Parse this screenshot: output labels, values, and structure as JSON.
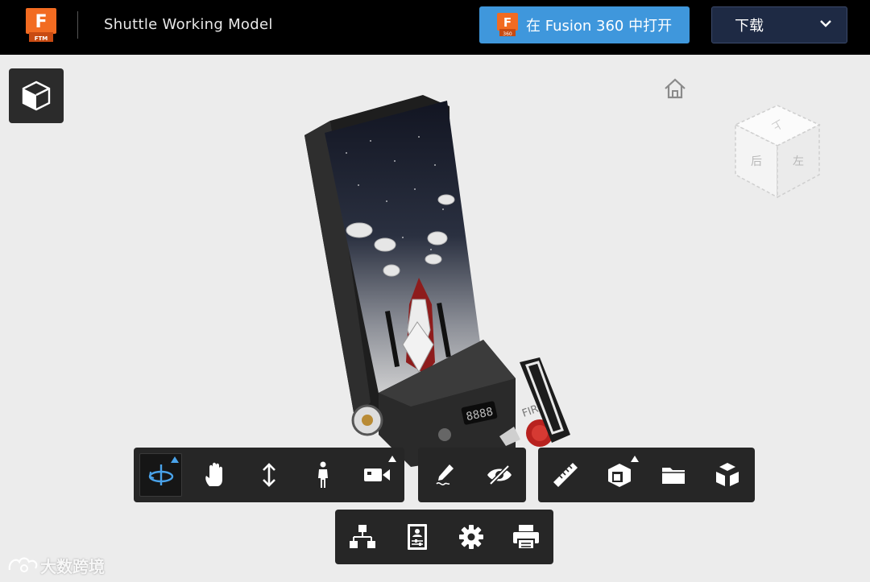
{
  "header": {
    "logo_label": "FTM",
    "doc_title": "Shuttle Working Model",
    "open_button_label": "在 Fusion 360 中打开",
    "open_button_badge": "360",
    "download_label": "下载"
  },
  "viewcube": {
    "face_top": "上",
    "face_front": "后",
    "face_right": "左"
  },
  "model": {
    "panel_text": "FIRE"
  },
  "toolbar_main": [
    {
      "name": "orbit-icon",
      "has_menu": true,
      "active": true
    },
    {
      "name": "pan-icon",
      "has_menu": false
    },
    {
      "name": "zoom-icon",
      "has_menu": false
    },
    {
      "name": "first-person-icon",
      "has_menu": false
    },
    {
      "name": "camera-icon",
      "has_menu": true
    }
  ],
  "toolbar_markup": [
    {
      "name": "markup-pencil-icon"
    },
    {
      "name": "hide-eye-icon"
    }
  ],
  "toolbar_inspect": [
    {
      "name": "measure-ruler-icon"
    },
    {
      "name": "section-box-icon",
      "has_menu": true
    },
    {
      "name": "folder-icon"
    },
    {
      "name": "explode-icon"
    }
  ],
  "toolbar_bottom": [
    {
      "name": "model-browser-icon"
    },
    {
      "name": "properties-icon"
    },
    {
      "name": "settings-gear-icon"
    },
    {
      "name": "print-icon"
    }
  ],
  "watermark": "大数跨境",
  "colors": {
    "accent_blue": "#3f97dc",
    "download_bg": "#1e2a44",
    "logo_orange": "#f26b21",
    "toolbar_bg": "#262626",
    "active_icon": "#4aa3ea"
  }
}
